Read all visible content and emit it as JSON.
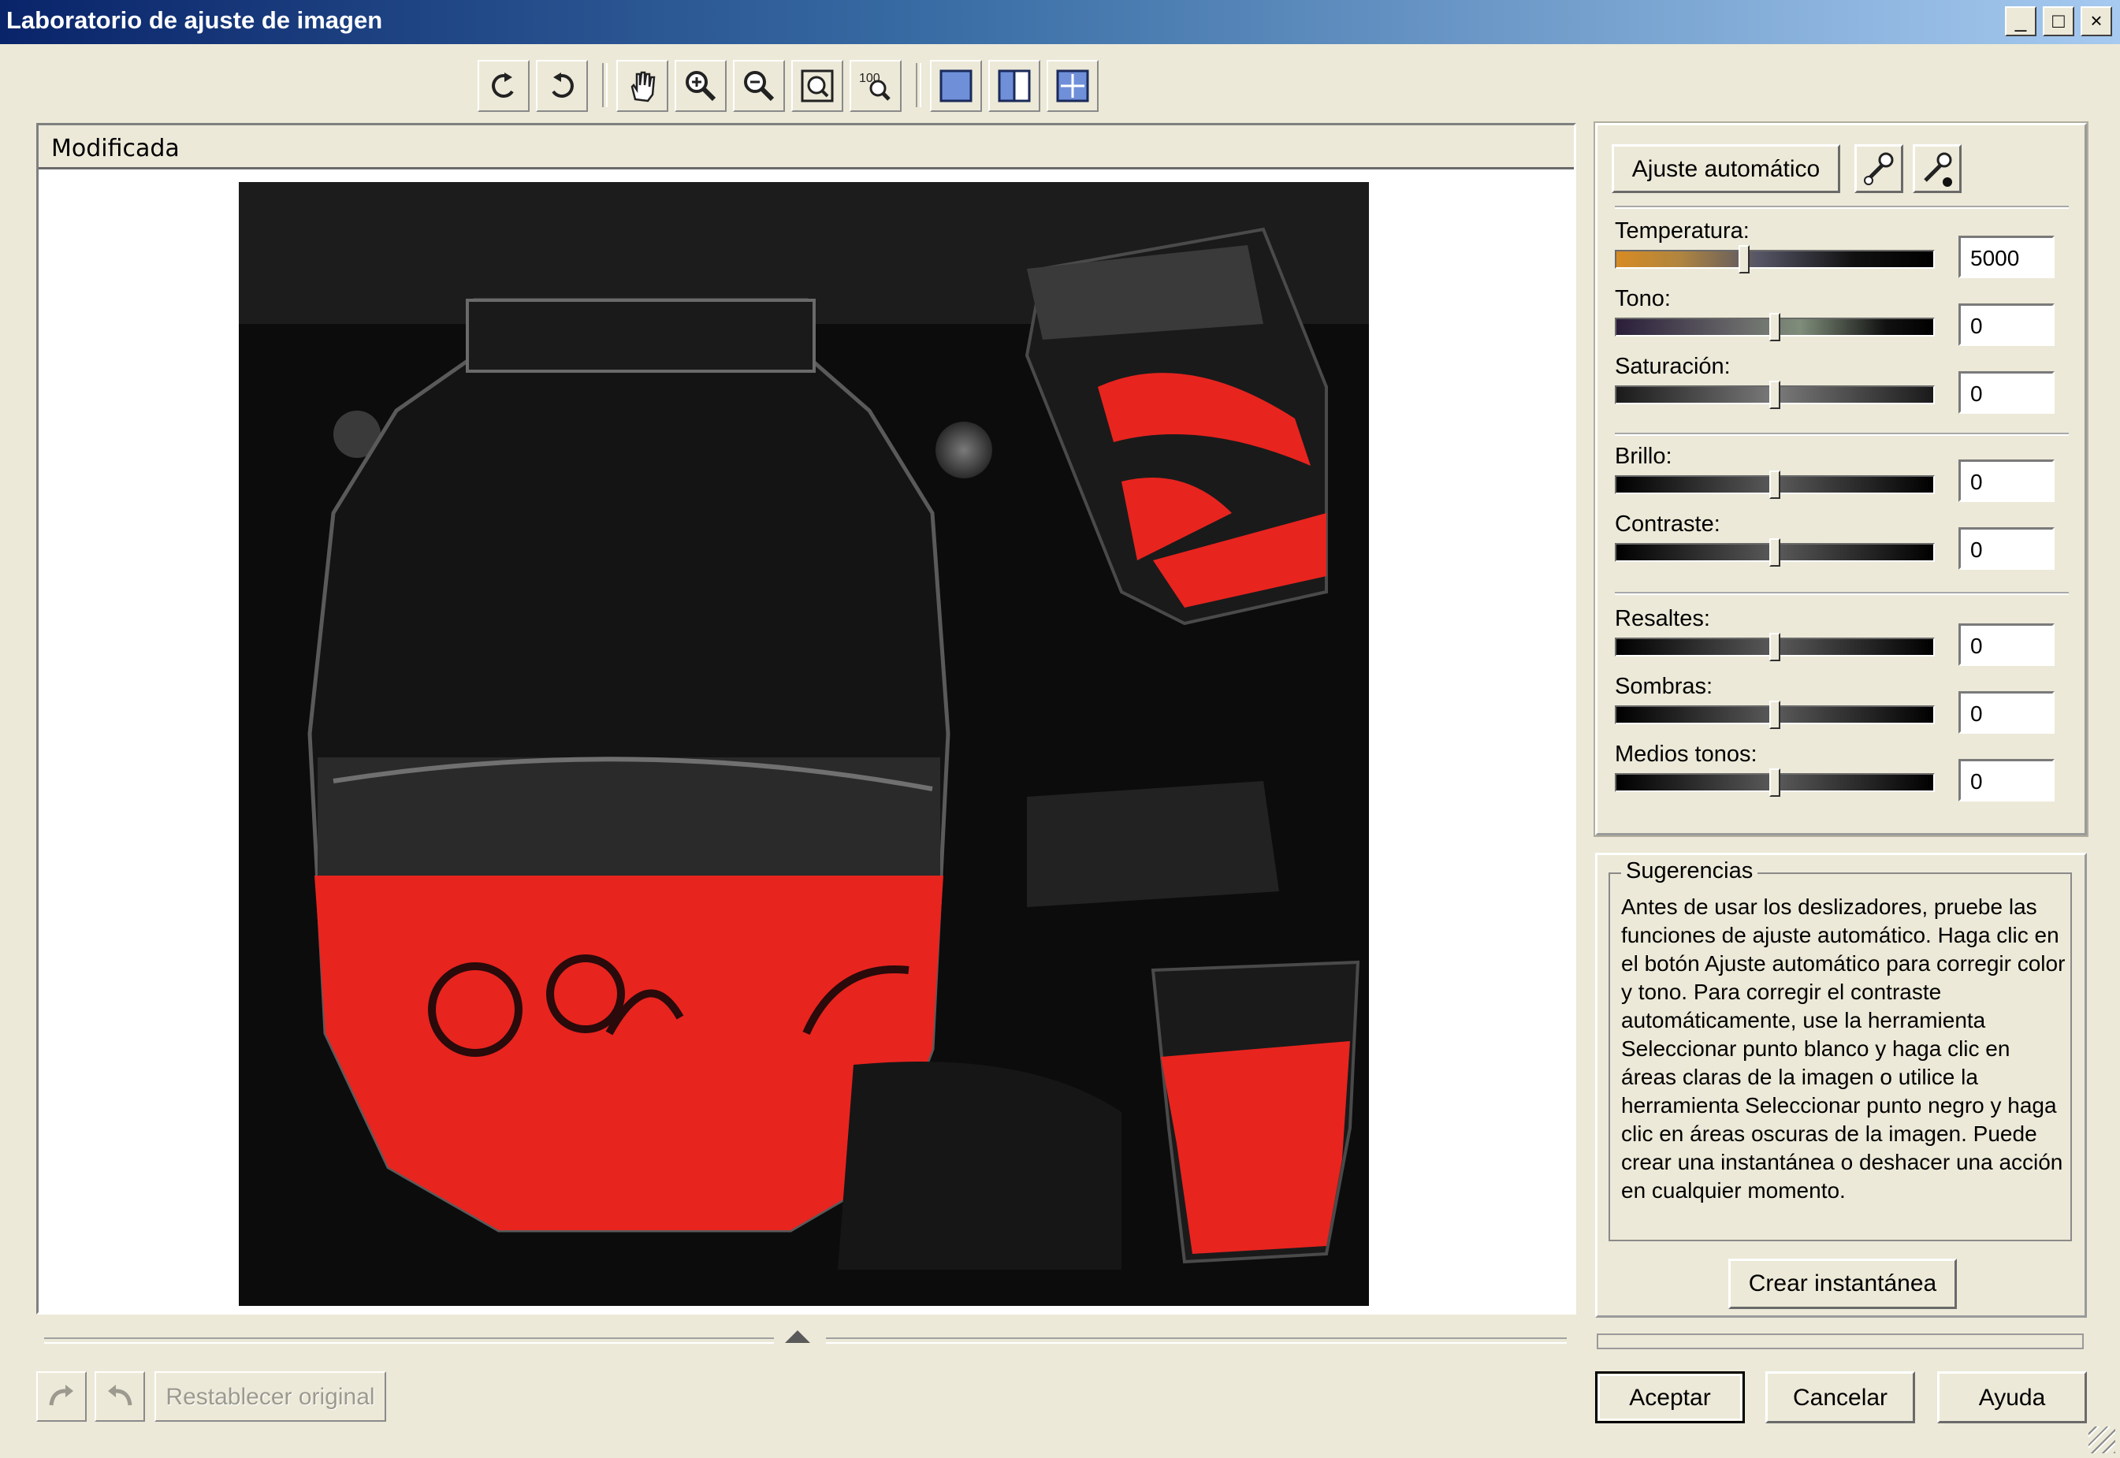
{
  "window": {
    "title": "Laboratorio de ajuste de imagen",
    "controls": {
      "minimize": "_",
      "maximize": "□",
      "close": "×"
    }
  },
  "toolbar": {
    "tools": [
      "rotate-left-icon",
      "rotate-right-icon",
      "hand-icon",
      "zoom-in-icon",
      "zoom-out-icon",
      "fit-icon",
      "actual-size-icon",
      "single-view-icon",
      "split-view-icon",
      "split-preview-icon"
    ],
    "actual_size_label": "100"
  },
  "preview": {
    "header": "Modificada"
  },
  "adjustments": {
    "auto_button": "Ajuste automático",
    "sliders": [
      {
        "label": "Temperatura:",
        "value": "5000",
        "position": 0.4
      },
      {
        "label": "Tono:",
        "value": "0",
        "position": 0.5
      },
      {
        "label": "Saturación:",
        "value": "0",
        "position": 0.5
      },
      {
        "label": "Brillo:",
        "value": "0",
        "position": 0.5
      },
      {
        "label": "Contraste:",
        "value": "0",
        "position": 0.5
      },
      {
        "label": "Resaltes:",
        "value": "0",
        "position": 0.5
      },
      {
        "label": "Sombras:",
        "value": "0",
        "position": 0.5
      },
      {
        "label": "Medios tonos:",
        "value": "0",
        "position": 0.5
      }
    ]
  },
  "hints": {
    "title": "Sugerencias",
    "text": "Antes de usar los deslizadores, pruebe las funciones de ajuste automático. Haga clic en el botón Ajuste automático para corregir color y tono. Para corregir el contraste automáticamente, use la herramienta Seleccionar punto blanco y haga clic en áreas claras de la imagen o utilice la herramienta Seleccionar punto negro y haga clic en áreas oscuras de la imagen. Puede crear una instantánea o deshacer una acción en cualquier momento.",
    "snapshot_button": "Crear instantánea"
  },
  "footer": {
    "reset_button": "Restablecer original",
    "ok_button": "Aceptar",
    "cancel_button": "Cancelar",
    "help_button": "Ayuda"
  },
  "colors": {
    "titlebar_start": "#0a246a",
    "titlebar_end": "#a6caf0",
    "dialog_bg": "#ece9d8",
    "photo_red": "#e8241f"
  }
}
